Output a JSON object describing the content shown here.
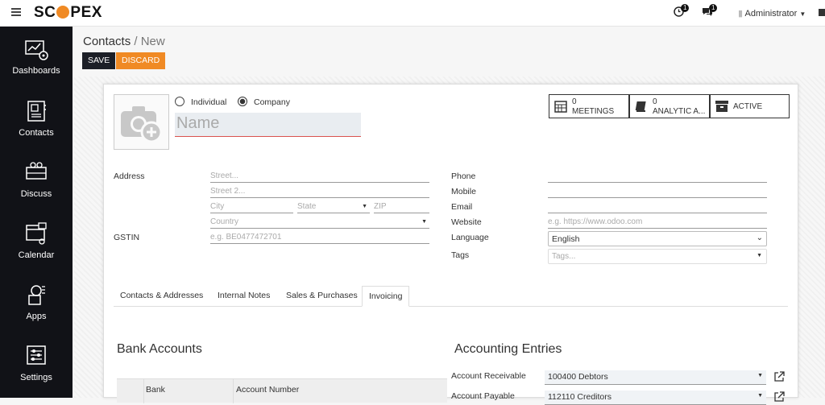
{
  "topbar": {
    "brand_pre": "SC",
    "brand_post": "PEX",
    "chat_count": "1",
    "msg_count": "1",
    "user": "Administrator"
  },
  "sidebar": [
    {
      "label": "Dashboards"
    },
    {
      "label": "Contacts"
    },
    {
      "label": "Discuss"
    },
    {
      "label": "Calendar"
    },
    {
      "label": "Apps"
    },
    {
      "label": "Settings"
    }
  ],
  "breadcrumb": {
    "parent": "Contacts",
    "sep": "/",
    "current": "New"
  },
  "buttons": {
    "save": "SAVE",
    "discard": "DISCARD"
  },
  "form": {
    "type_individual": "Individual",
    "type_company": "Company",
    "name_placeholder": "Name",
    "stats": [
      {
        "count": "0",
        "label": "MEETINGS"
      },
      {
        "count": "0",
        "label": "ANALYTIC A..."
      },
      {
        "count": "",
        "label": "ACTIVE"
      }
    ],
    "address_label": "Address",
    "street": "Street...",
    "street2": "Street 2...",
    "city": "City",
    "state": "State",
    "zip": "ZIP",
    "country": "Country",
    "gstin_label": "GSTIN",
    "gstin_placeholder": "e.g. BE0477472701",
    "phone_label": "Phone",
    "mobile_label": "Mobile",
    "email_label": "Email",
    "website_label": "Website",
    "website_placeholder": "e.g. https://www.odoo.com",
    "language_label": "Language",
    "language_value": "English",
    "tags_label": "Tags",
    "tags_placeholder": "Tags..."
  },
  "tabs": [
    "Contacts & Addresses",
    "Internal Notes",
    "Sales & Purchases",
    "Invoicing"
  ],
  "bank": {
    "title": "Bank Accounts",
    "col_bank": "Bank",
    "col_account": "Account Number"
  },
  "accounting": {
    "title": "Accounting Entries",
    "receivable_label": "Account Receivable",
    "receivable_value": "100400 Debtors",
    "payable_label": "Account Payable",
    "payable_value": "112110 Creditors"
  }
}
